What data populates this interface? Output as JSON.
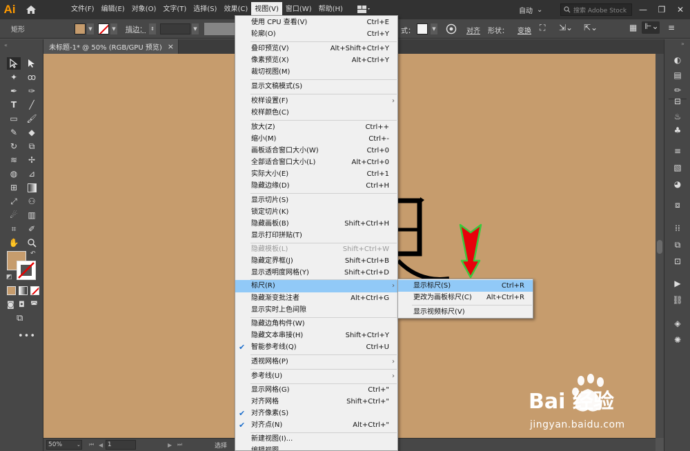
{
  "app": {
    "logo": "Ai",
    "home_icon": "home-icon"
  },
  "menubar": {
    "items": [
      "文件(F)",
      "编辑(E)",
      "对象(O)",
      "文字(T)",
      "选择(S)",
      "效果(C)",
      "视图(V)",
      "窗口(W)",
      "帮助(H)"
    ],
    "workspace": "自动",
    "search_placeholder": "搜索 Adobe Stock"
  },
  "controlbar": {
    "tool_name": "矩形",
    "stroke_label": "描边：",
    "style_suffix": "式：",
    "align_label": "对齐",
    "shape_label": "形状：",
    "transform_label": "变换"
  },
  "document": {
    "tab_title": "未标题-1* @ 50% (RGB/GPU 预览)",
    "close_glyph": "×"
  },
  "statusbar": {
    "zoom": "50%",
    "page": "1",
    "status": "选择"
  },
  "view_menu": {
    "items": [
      {
        "label": "使用 CPU 查看(V)",
        "shortcut": "Ctrl+E"
      },
      {
        "label": "轮廓(O)",
        "shortcut": "Ctrl+Y"
      },
      {
        "label": "叠印预览(V)",
        "shortcut": "Alt+Shift+Ctrl+Y"
      },
      {
        "label": "像素预览(X)",
        "shortcut": "Alt+Ctrl+Y"
      },
      {
        "label": "裁切视图(M)",
        "shortcut": ""
      },
      {
        "label": "显示文稿模式(S)",
        "shortcut": ""
      },
      {
        "label": "校样设置(F)",
        "shortcut": ""
      },
      {
        "label": "校样颜色(C)",
        "shortcut": ""
      },
      {
        "label": "放大(Z)",
        "shortcut": "Ctrl++"
      },
      {
        "label": "缩小(M)",
        "shortcut": "Ctrl+-"
      },
      {
        "label": "画板适合窗口大小(W)",
        "shortcut": "Ctrl+0"
      },
      {
        "label": "全部适合窗口大小(L)",
        "shortcut": "Alt+Ctrl+0"
      },
      {
        "label": "实际大小(E)",
        "shortcut": "Ctrl+1"
      },
      {
        "label": "隐藏边缘(D)",
        "shortcut": "Ctrl+H"
      },
      {
        "label": "显示切片(S)",
        "shortcut": ""
      },
      {
        "label": "锁定切片(K)",
        "shortcut": ""
      },
      {
        "label": "隐藏画板(B)",
        "shortcut": "Shift+Ctrl+H"
      },
      {
        "label": "显示打印拼贴(T)",
        "shortcut": ""
      },
      {
        "label": "隐藏模板(L)",
        "shortcut": "Shift+Ctrl+W"
      },
      {
        "label": "隐藏定界框(J)",
        "shortcut": "Shift+Ctrl+B"
      },
      {
        "label": "显示透明度网格(Y)",
        "shortcut": "Shift+Ctrl+D"
      },
      {
        "label": "标尺(R)",
        "shortcut": ""
      },
      {
        "label": "隐藏渐变批注者",
        "shortcut": "Alt+Ctrl+G"
      },
      {
        "label": "显示实时上色间隙",
        "shortcut": ""
      },
      {
        "label": "隐藏边角构件(W)",
        "shortcut": ""
      },
      {
        "label": "隐藏文本串接(H)",
        "shortcut": "Shift+Ctrl+Y"
      },
      {
        "label": "智能参考线(Q)",
        "shortcut": "Ctrl+U"
      },
      {
        "label": "透视网格(P)",
        "shortcut": ""
      },
      {
        "label": "参考线(U)",
        "shortcut": ""
      },
      {
        "label": "显示网格(G)",
        "shortcut": "Ctrl+\""
      },
      {
        "label": "对齐网格",
        "shortcut": "Shift+Ctrl+\""
      },
      {
        "label": "对齐像素(S)",
        "shortcut": ""
      },
      {
        "label": "对齐点(N)",
        "shortcut": "Alt+Ctrl+\""
      },
      {
        "label": "新建视图(I)...",
        "shortcut": ""
      },
      {
        "label": "编辑视图...",
        "shortcut": ""
      }
    ]
  },
  "ruler_menu": {
    "items": [
      {
        "label": "显示标尺(S)",
        "shortcut": "Ctrl+R"
      },
      {
        "label": "更改为画板标尺(C)",
        "shortcut": "Alt+Ctrl+R"
      },
      {
        "label": "显示视频标尺(V)",
        "shortcut": ""
      }
    ]
  },
  "colors": {
    "canvas": "#c69c6d",
    "menu_highlight": "#91c9f7",
    "arrow_fill": "#e8000b",
    "arrow_outline": "#3cc83c"
  },
  "watermark": {
    "brand": "Bai  经验",
    "url": "jingyan.baidu.com"
  }
}
